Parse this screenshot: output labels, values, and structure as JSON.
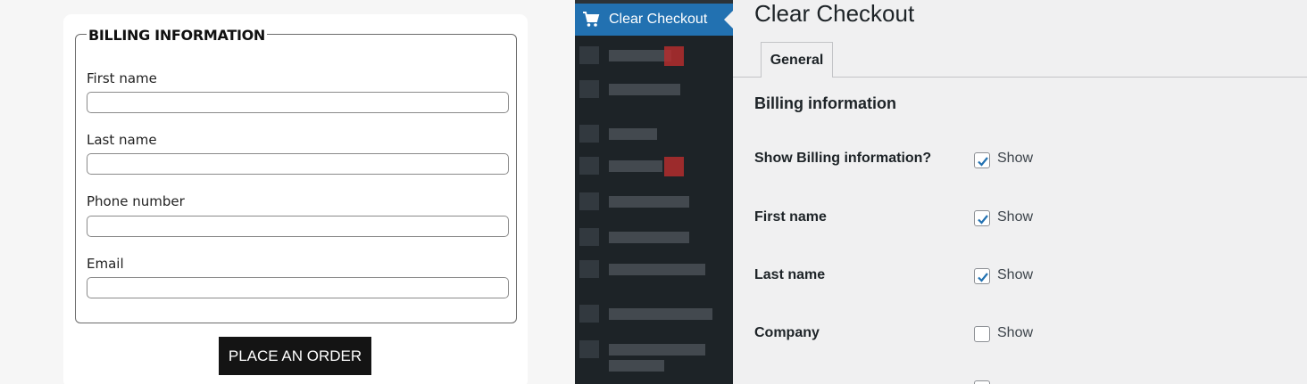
{
  "checkout_form": {
    "legend": "BILLING INFORMATION",
    "fields": [
      {
        "label": "First name",
        "value": ""
      },
      {
        "label": "Last name",
        "value": ""
      },
      {
        "label": "Phone number",
        "value": ""
      },
      {
        "label": "Email",
        "value": ""
      }
    ],
    "submit_label": "PLACE AN ORDER"
  },
  "sidebar": {
    "active_item": "Clear Checkout",
    "active_icon": "cart-icon",
    "active_color": "#2271b1",
    "background_color": "#1d2327"
  },
  "settings": {
    "page_title": "Clear Checkout",
    "tabs": [
      {
        "label": "General",
        "active": true
      }
    ],
    "section_title": "Billing information",
    "rows": [
      {
        "label": "Show Billing information?",
        "option_label": "Show",
        "checked": true
      },
      {
        "label": "First name",
        "option_label": "Show",
        "checked": true
      },
      {
        "label": "Last name",
        "option_label": "Show",
        "checked": true
      },
      {
        "label": "Company",
        "option_label": "Show",
        "checked": false
      }
    ],
    "checkbox_color": "#2271b1"
  }
}
